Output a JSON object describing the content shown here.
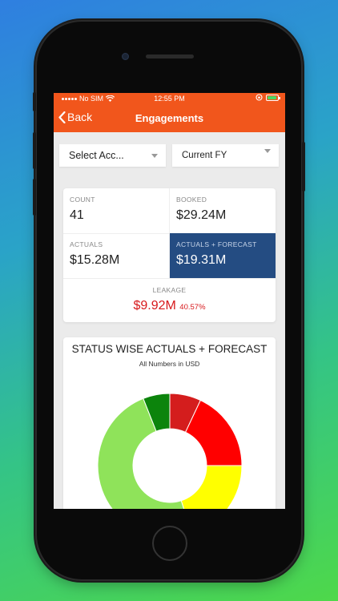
{
  "status_bar": {
    "carrier": "No SIM",
    "time": "12:55 PM"
  },
  "nav": {
    "back_label": "Back",
    "title": "Engagements"
  },
  "filters": {
    "account": "Select Acc...",
    "period": "Current FY"
  },
  "stats": {
    "count": {
      "label": "COUNT",
      "value": "41"
    },
    "booked": {
      "label": "BOOKED",
      "value": "$29.24M"
    },
    "actuals": {
      "label": "ACTUALS",
      "value": "$15.28M"
    },
    "actuals_forecast": {
      "label": "ACTUALS + FORECAST",
      "value": "$19.31M"
    },
    "leakage": {
      "label": "LEAKAGE",
      "value": "$9.92M",
      "percent": "40.57%"
    }
  },
  "chart_data": {
    "type": "pie",
    "title": "STATUS WISE ACTUALS + FORECAST",
    "subtitle": "All Numbers in USD",
    "slices": [
      {
        "color": "#d41d1d",
        "fraction": 0.07
      },
      {
        "color": "#ff0000",
        "fraction": 0.18
      },
      {
        "color": "#ffff00",
        "fraction": 0.2
      },
      {
        "color": "#8fe35a",
        "fraction": 0.49
      },
      {
        "color": "#0c840c",
        "fraction": 0.06
      }
    ]
  }
}
